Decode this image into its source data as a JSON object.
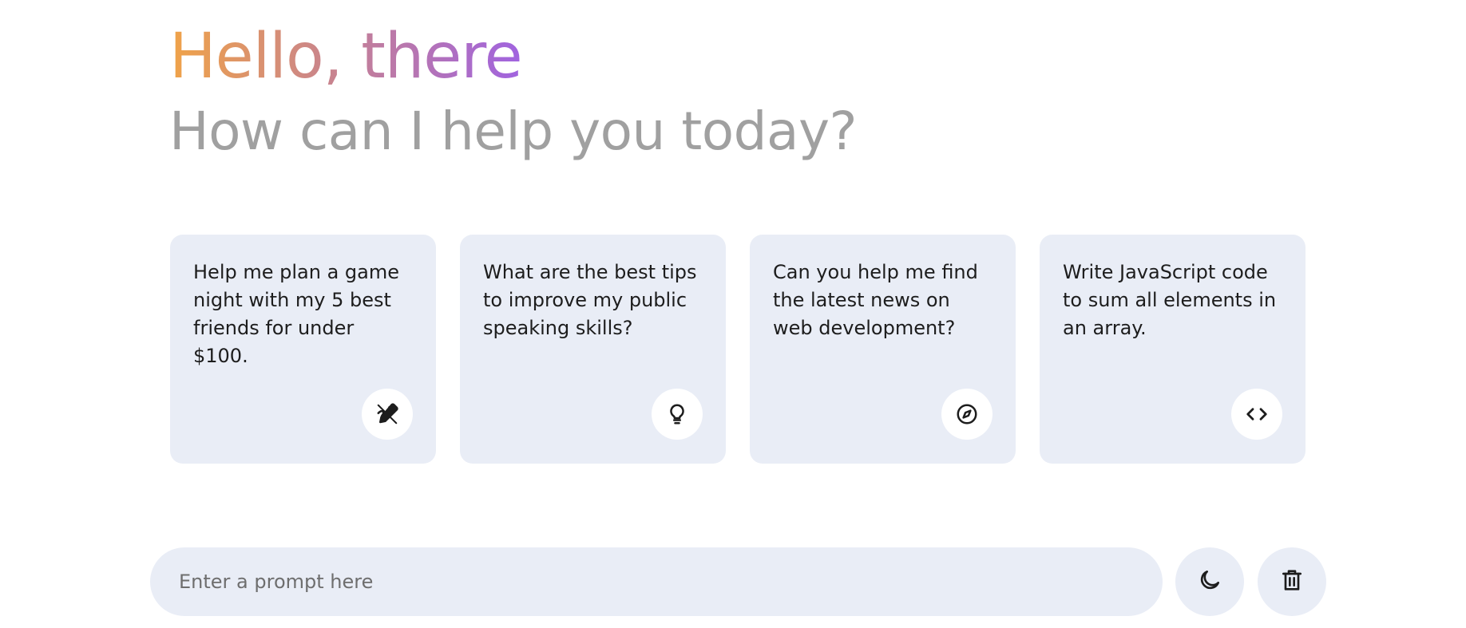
{
  "header": {
    "greeting": "Hello, there",
    "subtitle": "How can I help you today?"
  },
  "suggestions": [
    {
      "text": "Help me plan a game night with my 5 best friends for under $100.",
      "icon": "draw-icon"
    },
    {
      "text": "What are the best tips to improve my public speaking skills?",
      "icon": "lightbulb-icon"
    },
    {
      "text": "Can you help me find the latest news on web development?",
      "icon": "explore-icon"
    },
    {
      "text": "Write JavaScript code to sum all elements in an array.",
      "icon": "code-icon"
    }
  ],
  "prompt": {
    "placeholder": "Enter a prompt here",
    "value": ""
  },
  "actions": {
    "theme_icon": "moon-icon",
    "delete_icon": "delete-icon"
  },
  "colors": {
    "gradient_start": "#f0a348",
    "gradient_end": "#a063e0",
    "subtitle": "#a0a0a0",
    "card_bg": "#e9edf6",
    "text": "#1d1d1d"
  }
}
